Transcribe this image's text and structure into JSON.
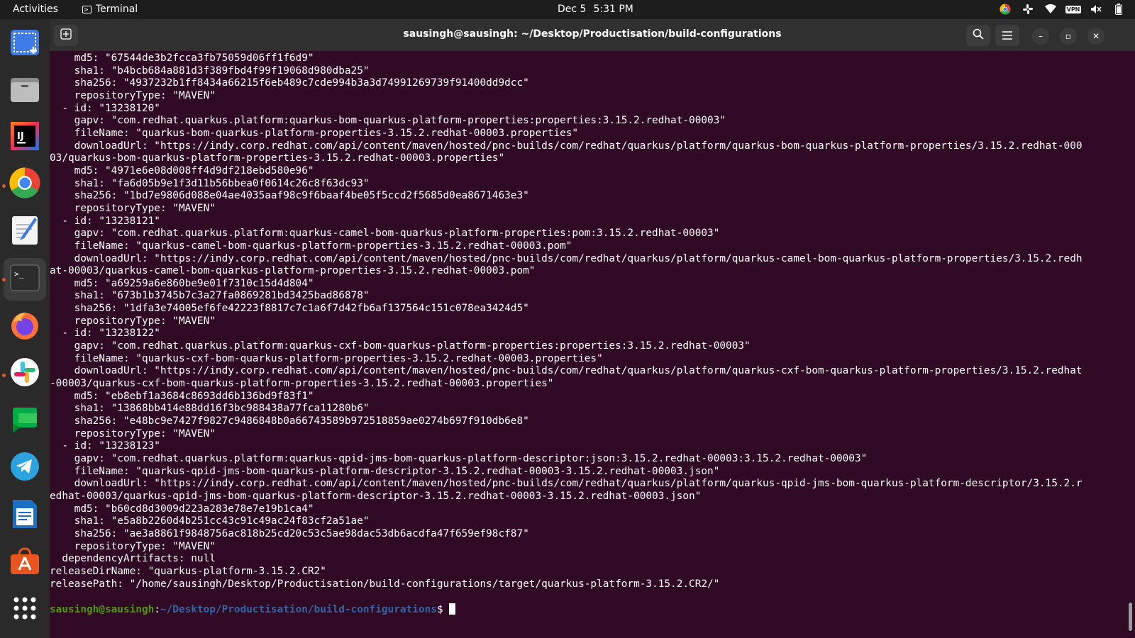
{
  "topbar": {
    "activities": "Activities",
    "app_name": "Terminal",
    "date": "Dec 5",
    "time": "5:31 PM",
    "tray_icons": [
      "chrome-icon",
      "slack-icon",
      "wifi-icon",
      "vpn-icon",
      "volume-icon",
      "battery-icon"
    ],
    "vpn_label": "VPN"
  },
  "dock": {
    "items": [
      {
        "name": "screenshot-app",
        "icon": "screenshot-icon"
      },
      {
        "name": "files",
        "icon": "folder-icon"
      },
      {
        "name": "intellij",
        "icon": "intellij-icon",
        "label": "IJ"
      },
      {
        "name": "chrome",
        "icon": "chrome-icon"
      },
      {
        "name": "text-editor",
        "icon": "text-editor-icon"
      },
      {
        "name": "terminal",
        "icon": "terminal-icon",
        "label": ">_"
      },
      {
        "name": "firefox",
        "icon": "firefox-icon"
      },
      {
        "name": "slack",
        "icon": "slack-icon"
      },
      {
        "name": "google-chat",
        "icon": "chat-icon"
      },
      {
        "name": "telegram",
        "icon": "telegram-icon"
      },
      {
        "name": "libreoffice-writer",
        "icon": "writer-icon"
      },
      {
        "name": "app-center",
        "icon": "app-center-icon"
      },
      {
        "name": "show-apps",
        "icon": "app-grid-icon"
      }
    ]
  },
  "window": {
    "title": "sausingh@sausingh: ~/Desktop/Productisation/build-configurations",
    "minimize": "–",
    "maximize": "▫",
    "close": "✕"
  },
  "terminal": {
    "lines": [
      "    md5: \"67544de3b2fcca3fb75059d06ff1f6d9\"",
      "    sha1: \"b4bcb684a881d3f389fbd4f99f19068d980dba25\"",
      "    sha256: \"4937232b1ff8434a66215f6eb489c7cde994b3a3d74991269739f91400dd9dcc\"",
      "    repositoryType: \"MAVEN\"",
      "  - id: \"13238120\"",
      "    gapv: \"com.redhat.quarkus.platform:quarkus-bom-quarkus-platform-properties:properties:3.15.2.redhat-00003\"",
      "    fileName: \"quarkus-bom-quarkus-platform-properties-3.15.2.redhat-00003.properties\"",
      "    downloadUrl: \"https://indy.corp.redhat.com/api/content/maven/hosted/pnc-builds/com/redhat/quarkus/platform/quarkus-bom-quarkus-platform-properties/3.15.2.redhat-000",
      "03/quarkus-bom-quarkus-platform-properties-3.15.2.redhat-00003.properties\"",
      "    md5: \"4971e6e08d008ff4d9df218ebd580e96\"",
      "    sha1: \"fa6d05b9e1f3d11b56bbea0f0614c26c8f63dc93\"",
      "    sha256: \"1bd7e9806d088e04ae4035aaf98c9f6baaf4be05f5ccd2f5685d0ea8671463e3\"",
      "    repositoryType: \"MAVEN\"",
      "  - id: \"13238121\"",
      "    gapv: \"com.redhat.quarkus.platform:quarkus-camel-bom-quarkus-platform-properties:pom:3.15.2.redhat-00003\"",
      "    fileName: \"quarkus-camel-bom-quarkus-platform-properties-3.15.2.redhat-00003.pom\"",
      "    downloadUrl: \"https://indy.corp.redhat.com/api/content/maven/hosted/pnc-builds/com/redhat/quarkus/platform/quarkus-camel-bom-quarkus-platform-properties/3.15.2.redh",
      "at-00003/quarkus-camel-bom-quarkus-platform-properties-3.15.2.redhat-00003.pom\"",
      "    md5: \"a69259a6e860be9e01f7310c15d4d804\"",
      "    sha1: \"673b1b3745b7c3a27fa0869281bd3425bad86878\"",
      "    sha256: \"1dfa3e74005ef6fe42223f8817c7c1a6f7d42fb6af137564c151c078ea3424d5\"",
      "    repositoryType: \"MAVEN\"",
      "  - id: \"13238122\"",
      "    gapv: \"com.redhat.quarkus.platform:quarkus-cxf-bom-quarkus-platform-properties:properties:3.15.2.redhat-00003\"",
      "    fileName: \"quarkus-cxf-bom-quarkus-platform-properties-3.15.2.redhat-00003.properties\"",
      "    downloadUrl: \"https://indy.corp.redhat.com/api/content/maven/hosted/pnc-builds/com/redhat/quarkus/platform/quarkus-cxf-bom-quarkus-platform-properties/3.15.2.redhat",
      "-00003/quarkus-cxf-bom-quarkus-platform-properties-3.15.2.redhat-00003.properties\"",
      "    md5: \"eb8ebf1a3684c8693dd6b136bd9f83f1\"",
      "    sha1: \"13868bb414e88dd16f3bc988438a77fca11280b6\"",
      "    sha256: \"e48bc9e7427f9827c9486848b0a66743589b972518859ae0274b697f910db6e8\"",
      "    repositoryType: \"MAVEN\"",
      "  - id: \"13238123\"",
      "    gapv: \"com.redhat.quarkus.platform:quarkus-qpid-jms-bom-quarkus-platform-descriptor:json:3.15.2.redhat-00003:3.15.2.redhat-00003\"",
      "    fileName: \"quarkus-qpid-jms-bom-quarkus-platform-descriptor-3.15.2.redhat-00003-3.15.2.redhat-00003.json\"",
      "    downloadUrl: \"https://indy.corp.redhat.com/api/content/maven/hosted/pnc-builds/com/redhat/quarkus/platform/quarkus-qpid-jms-bom-quarkus-platform-descriptor/3.15.2.r",
      "edhat-00003/quarkus-qpid-jms-bom-quarkus-platform-descriptor-3.15.2.redhat-00003-3.15.2.redhat-00003.json\"",
      "    md5: \"b60cd8d3009d223a283e78e7e19b1ca4\"",
      "    sha1: \"e5a8b2260d4b251cc43c91c49ac24f83cf2a51ae\"",
      "    sha256: \"ae3a8861f9848756ac818b25cd20c53c5ae98dac53db6acdfa47f659ef98cf87\"",
      "    repositoryType: \"MAVEN\"",
      "  dependencyArtifacts: null",
      "releaseDirName: \"quarkus-platform-3.15.2.CR2\"",
      "releasePath: \"/home/sausingh/Desktop/Productisation/build-configurations/target/quarkus-platform-3.15.2.CR2/\""
    ],
    "prompt_user": "sausingh@sausingh",
    "prompt_sep": ":",
    "prompt_path": "~/Desktop/Productisation/build-configurations",
    "prompt_symbol": "$ "
  },
  "colors": {
    "terminal_bg": "#300a24",
    "prompt_user": "#4e9a06",
    "prompt_path": "#3465a4",
    "accent": "#e95420"
  }
}
